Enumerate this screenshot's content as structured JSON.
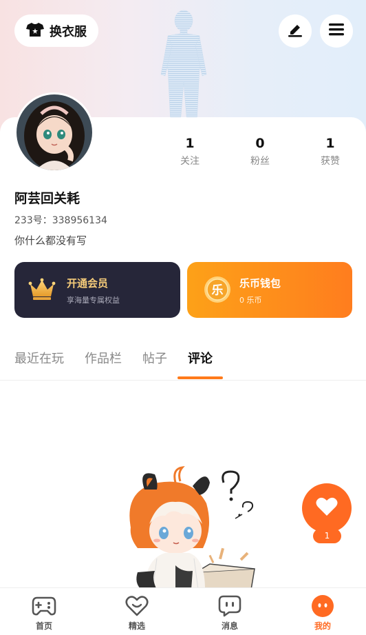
{
  "header": {
    "dress_up_label": "换衣服",
    "edit_icon": "pencil-icon",
    "menu_icon": "hamburger-menu-icon"
  },
  "profile": {
    "username": "阿芸回关耗",
    "uid_text": "233号：338956134",
    "bio": "你什么都没有写",
    "stats": [
      {
        "value": "1",
        "label": "关注"
      },
      {
        "value": "0",
        "label": "粉丝"
      },
      {
        "value": "1",
        "label": "获赞"
      }
    ]
  },
  "promos": {
    "vip": {
      "title": "开通会员",
      "subtitle": "享海量专属权益",
      "icon": "crown-icon"
    },
    "wallet": {
      "title": "乐币钱包",
      "subtitle": "0 乐币",
      "icon": "coin-icon",
      "coin_char": "乐"
    }
  },
  "tabs": [
    {
      "label": "最近在玩",
      "active": false
    },
    {
      "label": "作品栏",
      "active": false
    },
    {
      "label": "帖子",
      "active": false
    },
    {
      "label": "评论",
      "active": true
    }
  ],
  "fab": {
    "icon": "heart-icon",
    "count": "1"
  },
  "bottom_nav": [
    {
      "label": "首页",
      "icon": "gamepad-icon",
      "active": false
    },
    {
      "label": "精选",
      "icon": "heart-outline-icon",
      "active": false
    },
    {
      "label": "消息",
      "icon": "chat-bubble-icon",
      "active": false
    },
    {
      "label": "我的",
      "icon": "face-icon",
      "active": true
    }
  ],
  "colors": {
    "accent": "#ff6a22",
    "vip_bg": "#262639",
    "vip_title": "#f6cc7a",
    "wallet_start": "#fda118",
    "wallet_end": "#ff7d1e"
  }
}
